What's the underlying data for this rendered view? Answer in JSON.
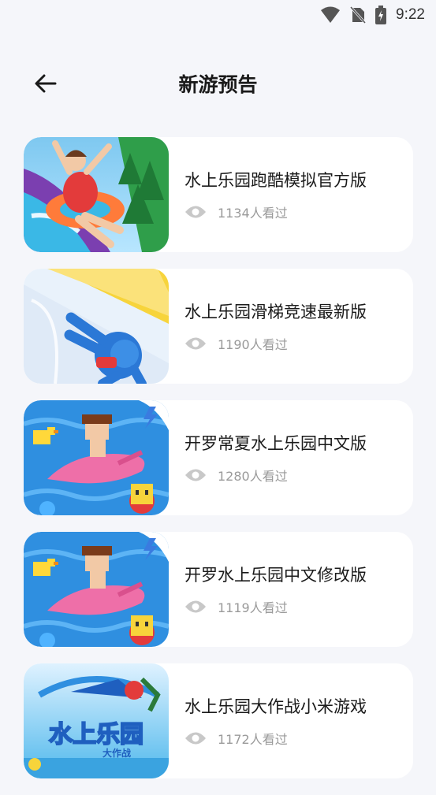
{
  "status": {
    "time": "9:22"
  },
  "header": {
    "title": "新游预告"
  },
  "games": [
    {
      "name": "水上乐园跑酷模拟官方版",
      "views": "1134人看过",
      "thumb": "waterslide-girl"
    },
    {
      "name": "水上乐园滑梯竞速最新版",
      "views": "1190人看过",
      "thumb": "slide-racer"
    },
    {
      "name": "开罗常夏水上乐园中文版",
      "views": "1280人看过",
      "thumb": "pixel-dolphin"
    },
    {
      "name": "开罗水上乐园中文修改版",
      "views": "1119人看过",
      "thumb": "pixel-dolphin"
    },
    {
      "name": "水上乐园大作战小米游戏",
      "views": "1172人看过",
      "thumb": "waterpark-logo",
      "logo_text": "水上乐园",
      "logo_sub": "大作战"
    }
  ],
  "colors": {
    "background": "#f5f6fa",
    "card": "#ffffff",
    "muted": "#9a9a9a"
  }
}
